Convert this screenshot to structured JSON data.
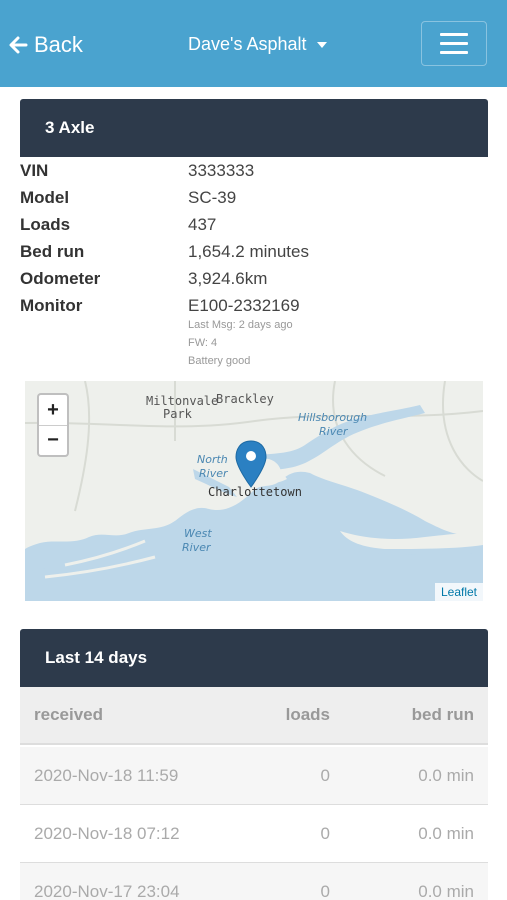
{
  "header": {
    "back_label": "Back",
    "company": "Dave's Asphalt",
    "back_icon": "arrow-left-icon",
    "menu_icon": "hamburger-icon"
  },
  "truck": {
    "title": "3 Axle",
    "specs": [
      {
        "label": "VIN",
        "value": "3333333"
      },
      {
        "label": "Model",
        "value": "SC-39"
      },
      {
        "label": "Loads",
        "value": "437"
      },
      {
        "label": "Bed run",
        "value": "1,654.2 minutes"
      },
      {
        "label": "Odometer",
        "value": "3,924.6km"
      },
      {
        "label": "Monitor",
        "value": "E100-2332169"
      }
    ],
    "monitor_details": {
      "last_msg": "Last Msg: 2 days ago",
      "fw": "FW: 4",
      "battery": "Battery good"
    }
  },
  "map": {
    "zoom_in": "+",
    "zoom_out": "−",
    "attribution": "Leaflet",
    "labels": {
      "miltonvale": "Miltonvale",
      "park": "Park",
      "brackley": "Brackley",
      "hillsborough": "Hillsborough",
      "hills_river": "River",
      "north": "North",
      "north_river": "River",
      "city": "Charlottetown",
      "west": "West",
      "west_river": "River"
    },
    "marker_icon": "map-pin-icon"
  },
  "history": {
    "title": "Last 14 days",
    "columns": {
      "received": "received",
      "loads": "loads",
      "bed_run": "bed run"
    },
    "rows": [
      {
        "received": "2020-Nov-18 11:59",
        "loads": "0",
        "bed_run": "0.0 min"
      },
      {
        "received": "2020-Nov-18 07:12",
        "loads": "0",
        "bed_run": "0.0 min"
      },
      {
        "received": "2020-Nov-17 23:04",
        "loads": "0",
        "bed_run": "0.0 min"
      }
    ]
  }
}
